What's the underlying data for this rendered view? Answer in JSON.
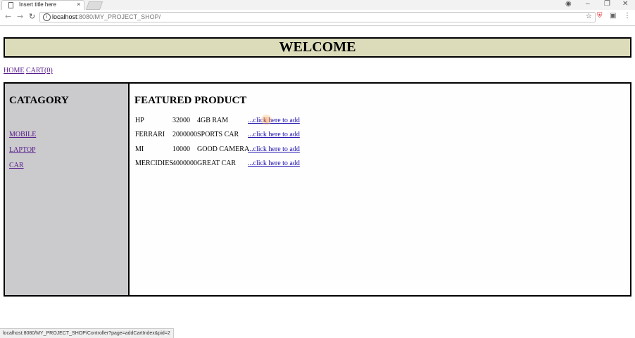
{
  "browser": {
    "tab_title": "Insert title here",
    "tab_close": "×",
    "url_host": "localhost",
    "url_path": ":8080/MY_PROJECT_SHOP/",
    "status_url": "localhost:8080/MY_PROJECT_SHOP/Controller?page=addCartIndex&pid=2"
  },
  "header": {
    "title": "WELCOME"
  },
  "nav": {
    "home": "HOME",
    "cart": "CART(0)"
  },
  "sidebar": {
    "heading": "CATAGORY",
    "items": [
      {
        "label": "MOBILE"
      },
      {
        "label": "LAPTOP"
      },
      {
        "label": "CAR"
      }
    ]
  },
  "main": {
    "heading": "FEATURED PRODUCT",
    "products": [
      {
        "name": "HP",
        "price": "32000",
        "desc": "4GB RAM",
        "link": "...click here to add"
      },
      {
        "name": "FERRARI",
        "price": "2000000",
        "desc": "SPORTS CAR",
        "link": "...click here to add"
      },
      {
        "name": "MI",
        "price": "10000",
        "desc": "GOOD CAMERA",
        "link": "...click here to add"
      },
      {
        "name": "MERCIDIES",
        "price": "4000000",
        "desc": "GREAT CAR",
        "link": "...click here to add"
      }
    ]
  },
  "colors": {
    "header_bg": "#dcdcba",
    "sidebar_bg": "#cbcacd",
    "link": "#1a0dab",
    "visited_link": "#551a8b"
  }
}
